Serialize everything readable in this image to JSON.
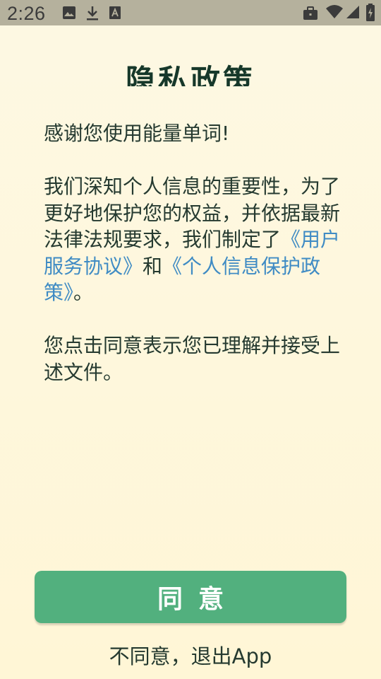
{
  "status_bar": {
    "time": "2:26",
    "left_icons": [
      "image-icon",
      "download-icon",
      "a-icon"
    ],
    "right_icons": [
      "briefcase-icon",
      "wifi-icon",
      "signal-icon",
      "battery-charging-icon"
    ]
  },
  "dialog": {
    "title": "隐私政策",
    "paragraph1": "感谢您使用能量单词!",
    "paragraph2_pre": "我们深知个人信息的重要性，为了更好地保护您的权益，并依据最新法律法规要求，我们制定了",
    "link_service": "《用户服务协议》",
    "paragraph2_and": "和",
    "link_privacy": "《个人信息保护政策》",
    "paragraph2_end": "。",
    "paragraph3": "您点击同意表示您已理解并接受上述文件。",
    "agree_label": "同意",
    "disagree_label": "不同意，退出App"
  },
  "colors": {
    "accent": "#52b07e",
    "link": "#3f8bc4",
    "status_bar": "#b5b19d",
    "text": "#253a30"
  }
}
